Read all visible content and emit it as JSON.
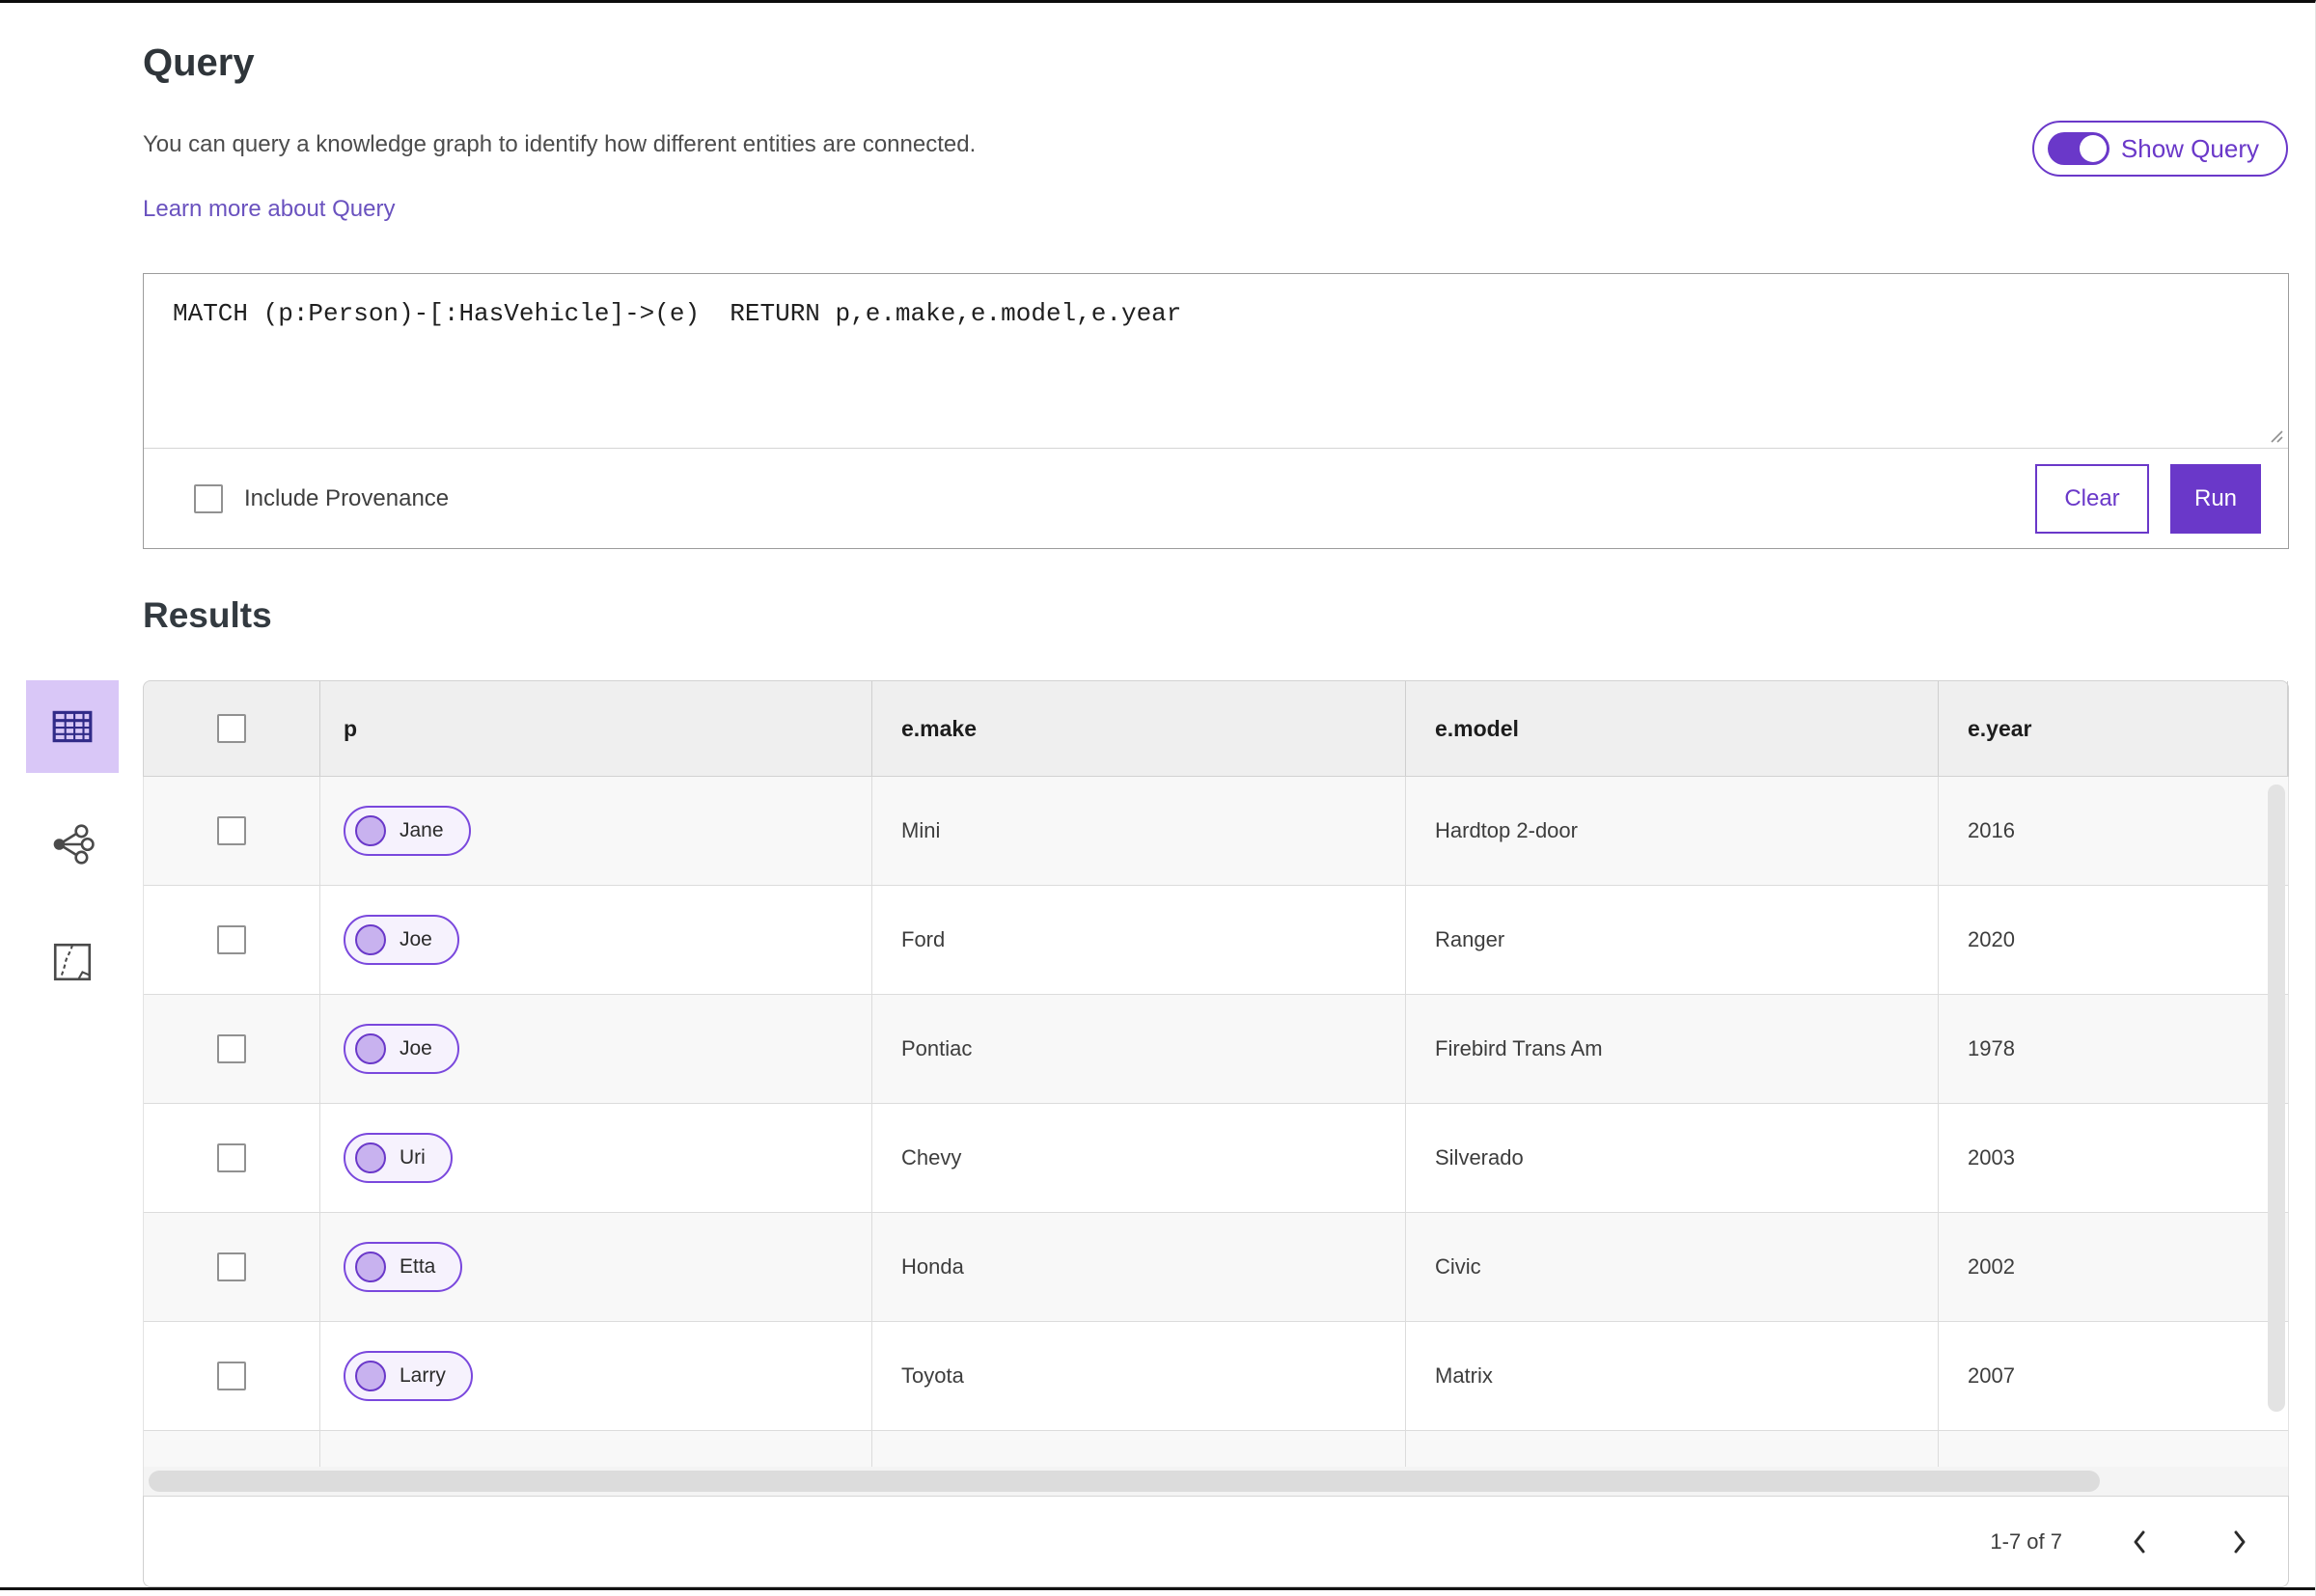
{
  "header": {
    "title": "Query",
    "description": "You can query a knowledge graph to identify how different entities are connected.",
    "learn_more_label": "Learn more about Query",
    "show_query_label": "Show Query",
    "show_query_on": true
  },
  "query_panel": {
    "query_text": "MATCH (p:Person)-[:HasVehicle]->(e)  RETURN p,e.make,e.model,e.year",
    "include_provenance_label": "Include Provenance",
    "include_provenance_checked": false,
    "clear_label": "Clear",
    "run_label": "Run"
  },
  "results": {
    "heading": "Results",
    "views": [
      {
        "name": "table-view",
        "icon": "table-icon",
        "selected": true
      },
      {
        "name": "link-chart-view",
        "icon": "link-chart-icon",
        "selected": false
      },
      {
        "name": "map-view",
        "icon": "map-icon",
        "selected": false
      }
    ],
    "table": {
      "columns": [
        "p",
        "e.make",
        "e.model",
        "e.year"
      ],
      "rows": [
        {
          "p": "Jane",
          "make": "Mini",
          "model": "Hardtop 2-door",
          "year": "2016"
        },
        {
          "p": "Joe",
          "make": "Ford",
          "model": "Ranger",
          "year": "2020"
        },
        {
          "p": "Joe",
          "make": "Pontiac",
          "model": "Firebird Trans Am",
          "year": "1978"
        },
        {
          "p": "Uri",
          "make": "Chevy",
          "model": "Silverado",
          "year": "2003"
        },
        {
          "p": "Etta",
          "make": "Honda",
          "model": "Civic",
          "year": "2002"
        },
        {
          "p": "Larry",
          "make": "Toyota",
          "model": "Matrix",
          "year": "2007"
        }
      ],
      "partial_row_visible": true
    },
    "pagination": {
      "range_label": "1-7 of 7",
      "prev_icon": "chevron-left-icon",
      "next_icon": "chevron-right-icon"
    }
  },
  "colors": {
    "accent": "#6a38c9",
    "accent_light": "#d9c7f7",
    "pill_border": "#7a48dd",
    "pill_background": "#f6f2fd",
    "pill_circle": "#c8b2ef",
    "link": "#6a52bf",
    "header_background": "#efefef",
    "row_alt_background": "#f8f8f8"
  }
}
